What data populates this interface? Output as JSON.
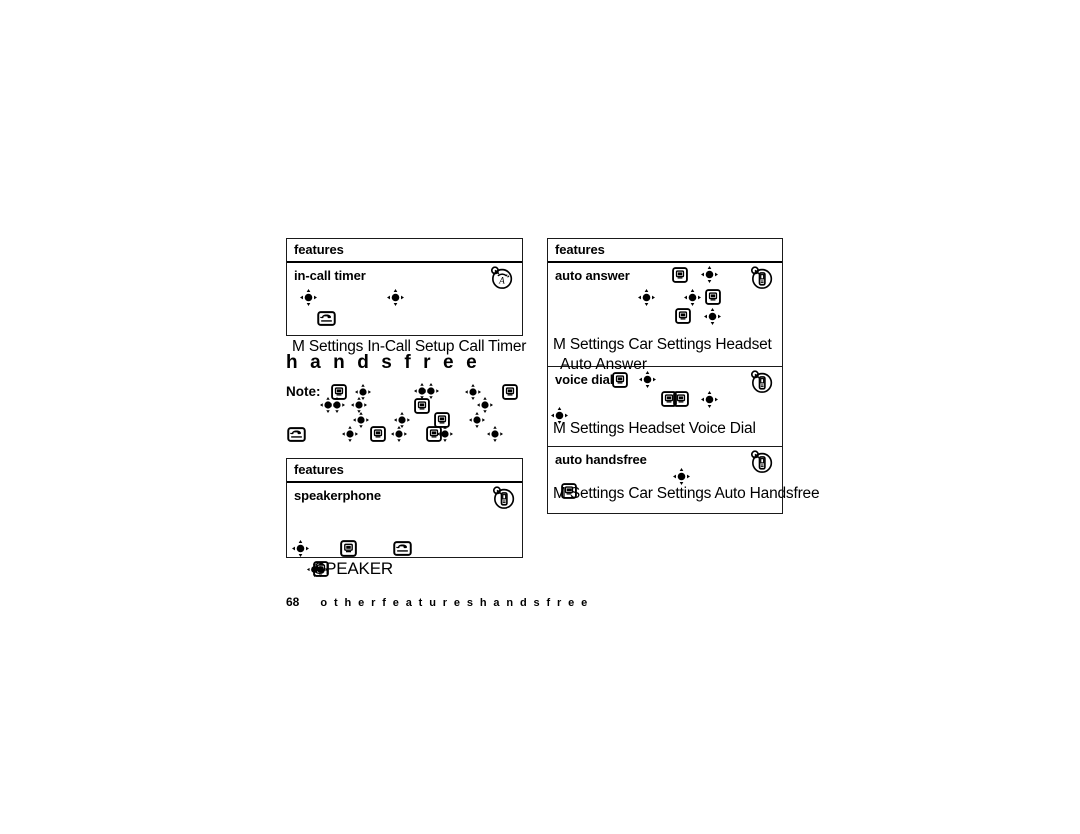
{
  "page": {
    "number": "68",
    "footer_trail": "o t h e r   f e a t u r e s     h a n d s f r e e",
    "footer_parts": [
      "other features",
      "handsfree"
    ]
  },
  "section": {
    "heading": "h a n d s f r e e",
    "heading_plain": "handsfree",
    "note_label": "Note:"
  },
  "tables": [
    {
      "id": "table-in-call-timer",
      "header": "features",
      "rows": [
        {
          "title": "in-call timer",
          "badge": "headset-alpha-badge-icon",
          "path": "M      Settings In-Call Setup Call Timer",
          "path_segments": [
            "M",
            "Settings",
            "In-Call Setup",
            "Call Timer"
          ]
        }
      ]
    },
    {
      "id": "table-speakerphone",
      "header": "features",
      "rows": [
        {
          "title": "speakerphone",
          "badge": "phone-badge-icon",
          "path": "SPEAKER",
          "path_segments": [
            "SPEAKER"
          ]
        }
      ]
    },
    {
      "id": "table-right",
      "header": "features",
      "rows": [
        {
          "title": "auto answer",
          "badge": "phone-badge-icon",
          "path": "M      Settings Car Settings Headset",
          "path_line2": "Auto Answer",
          "path_segments": [
            "M",
            "Settings",
            "Car Settings",
            "Headset",
            "Auto Answer"
          ]
        },
        {
          "title": "voice dial",
          "badge": "phone-badge-icon",
          "path": "M      Settings Headset Voice Dial",
          "path_segments": [
            "M",
            "Settings",
            "Headset",
            "Voice Dial"
          ]
        },
        {
          "title": "auto handsfree",
          "badge": "phone-badge-icon",
          "path": "M      Settings Car Settings Auto Handsfree",
          "path_segments": [
            "M",
            "Settings",
            "Car Settings",
            "Auto Handsfree"
          ]
        }
      ]
    }
  ],
  "speaker_label": "SPEAKER",
  "icons": {
    "nav_key": "four-way-navigation-key-icon",
    "menu_key": "menu-key-icon",
    "send_key": "send-key-icon",
    "phone_badge": "phone-badge-icon",
    "headset_badge": "headset-badge-icon"
  },
  "colors": {
    "ink": "#000000",
    "paper": "#ffffff",
    "rule": "#1a1a1a"
  }
}
